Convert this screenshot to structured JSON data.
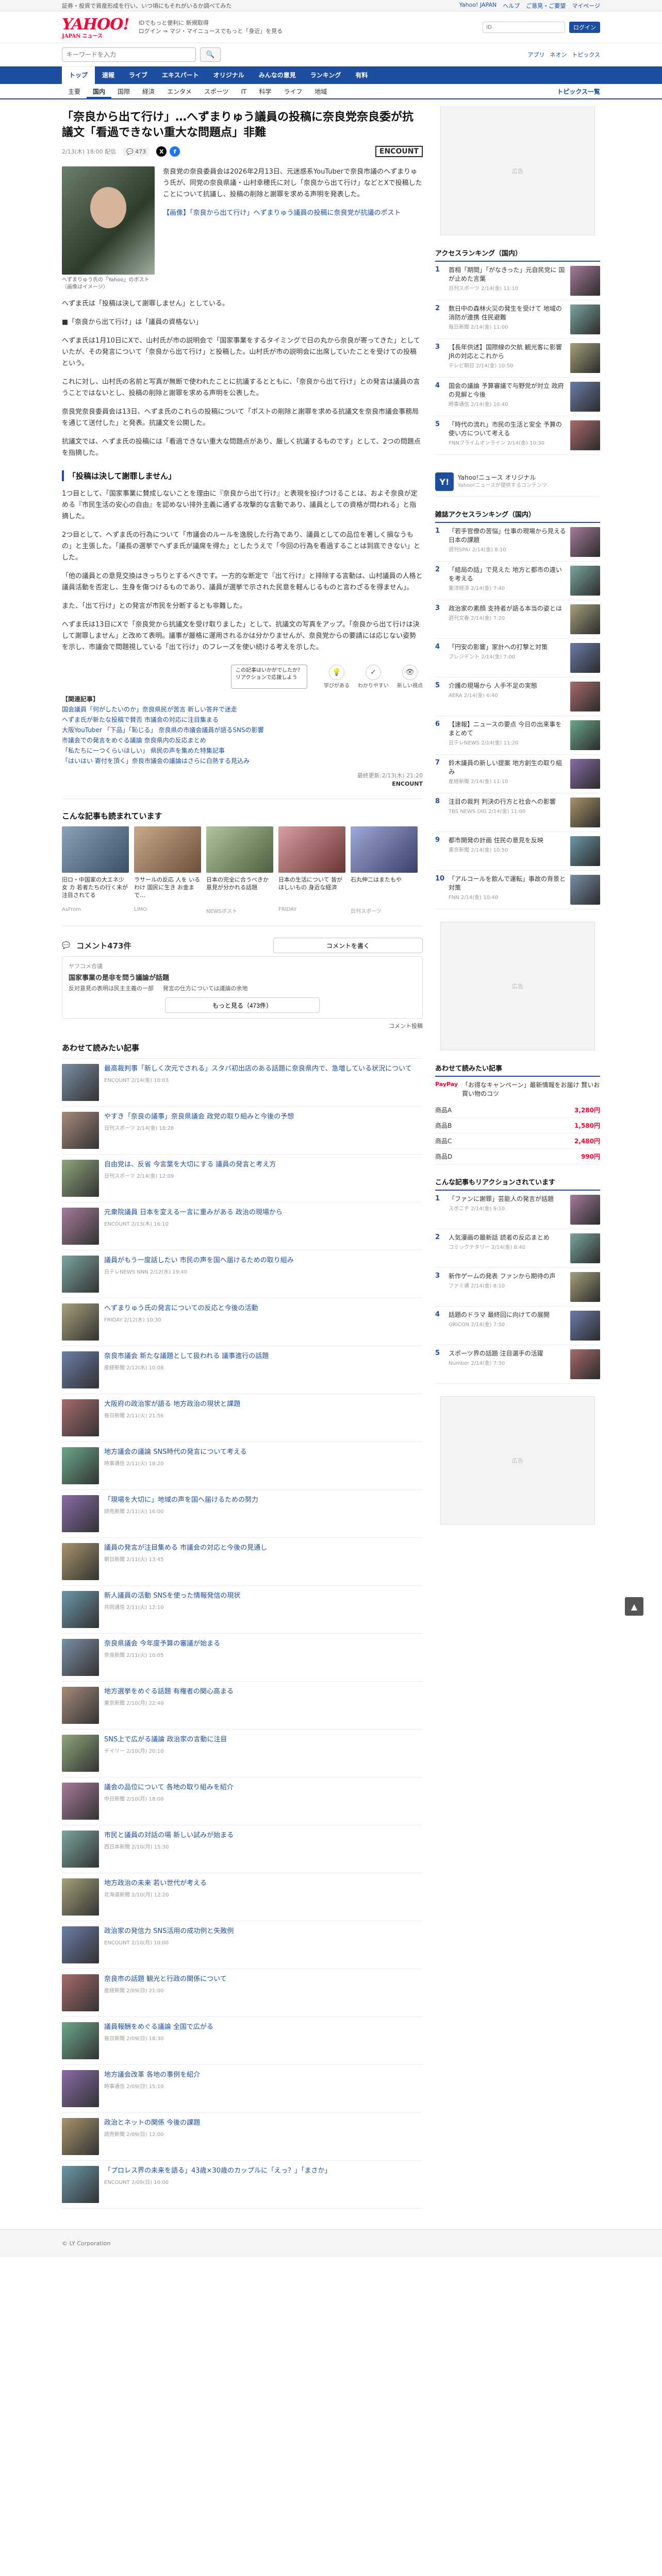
{
  "topstrip": {
    "left": "証券・投資で資産形成を行い、いつ頃にもそれがいるか調べてみた",
    "links": [
      "Yahoo! JAPAN",
      "ヘルプ",
      "ご意見・ご要望",
      "マイページ"
    ]
  },
  "header": {
    "logo": "YAHOO!",
    "logo_sub": "JAPAN ニュース",
    "subnav1": "IDでもっと便利に 新規取得",
    "subnav2": "ログイン ⇒ マジ・マイニュースでもっと「身近」を見る",
    "login_placeholder": "ID",
    "login_btn": "ログイン"
  },
  "search": {
    "placeholder": "キーワードを入力",
    "btn": "検索",
    "right": [
      "アプリ",
      "ネオン",
      "トピックス"
    ]
  },
  "nav": [
    "トップ",
    "速報",
    "ライブ",
    "エキスパート",
    "オリジナル",
    "みんなの意見",
    "ランキング",
    "有料"
  ],
  "subnav": [
    "主要",
    "国内",
    "国際",
    "経済",
    "エンタメ",
    "スポーツ",
    "IT",
    "科学",
    "ライフ",
    "地域"
  ],
  "subnav_right": "トピックス一覧",
  "article": {
    "title": "「奈良から出て行け」…へずまりゅう議員の投稿に奈良党奈良委が抗議文「看過できない重大な問題点」非難",
    "date": "2/13(木) 18:00 配信",
    "comments": "473",
    "provider": "ENCOUNT",
    "photo_caption": "へずまりゅう氏の「Yahoo」のポスト（画像はイメージ）",
    "lead_p1": "奈良党の奈良委員会は2026年2月13日、元迷惑系YouTuberで奈良市議のへずまりゅう氏が、同党の奈良県議・山村幸穂氏に対し「奈良から出て行け」などとXで投稿したことについて抗議し、投稿の削除と謝罪を求める声明を発表した。",
    "lead_link": "【画像】「奈良から出て行け」へずまりゅう議員の投稿に奈良党が抗議のポスト",
    "p1": "へずま氏は「投稿は決して謝罪しません」としている。",
    "p2": "■「奈良から出て行け」は「議員の資格ない」",
    "p3": "へずま氏は1月10日にXで、山村氏が市の説明会で「国家事業をするタイミングで日の丸から奈良が寄ってきた」としていたが、その発言について「奈良から出て行け」と投稿した。山村氏が市の説明会に出席していたことを受けての投稿という。",
    "p4": "これに対し、山村氏の名前と写真が無断で使われたことに抗議するとともに、「奈良から出て行け」との発言は議員の言うことではないとし、投稿の削除と謝罪を求める声明を公表した。",
    "p5": "奈良党奈良委員会は13日、へずま氏のこれらの投稿について「ポストの削除と謝罪を求める抗議文を奈良市議会事務局を通じて送付した」と発表。抗議文を公開した。",
    "p6": "抗議文では、へずま氏の投稿には「看過できない重大な問題点があり、厳しく抗議するものです」として、2つの問題点を指摘した。",
    "h1": "「投稿は決して謝罪しません」",
    "p7": "1つ目として、「国家事業に賛成しないことを理由に『奈良から出て行け』と表現を投げつけることは、およそ奈良が定める『市民生活の安心の自由』を認めない排外主義に通ずる攻撃的な言動であり、議員としての資格が問われる」と指摘した。",
    "p8": "2つ目として、へずま氏の行為について「市議会のルールを逸脱した行為であり、議員としての品位を著しく損なうもの」と主張した。「議長の選挙でへずま氏が議席を得た」としたうえで「今回の行為を看過することは到底できない」とした。",
    "p9": "「他の議員との意見交換はきっちりとするべきです。一方的な断定で『出て行け』と排除する言動は、山村議員の人格と議員活動を否定し、生身を傷つけるものであり、議員が選挙で示された民意を軽んじるものと言わざるを得ません」。",
    "p10": "また、「出て行け」との発言が市民を分断するとも非難した。",
    "p11": "へずま氏は13日にXで「奈良党から抗議文を受け取りました」として、抗議文の写真をアップ。「奈良から出て行けは決して謝罪しません」と改めて表明。議事が厳格に運用されるかは分かりませんが、奈良党からの要請には応じない姿勢を示し、市議会で問題視している「出て行け」のフレーズを使い続ける考えを示した。",
    "tooltip1": "この記事はいかがでしたか？",
    "tooltip2": "リアクションで応援しよう",
    "reactions": [
      "学びがある",
      "わかりやすい",
      "新しい視点"
    ],
    "related_label": "【関連記事】",
    "related": [
      "国会議員「何がしたいのか」奈良県民が苦言 新しい答弁で迷走",
      "ヘずま氏が新たな投稿で賛否 市議会の対応に注目集まる",
      "大阪YouTuber 「下品」「恥じる」 奈良県の市議会議員が語るSNSの影響",
      "市議会での発言をめぐる議論 奈良県内の反応まとめ",
      "「私たちに一つくらいほしい」 県民の声を集めた特集記事",
      "「はいはい 寄付を頂く」奈良市議会の議論はさらに白熱する見込み"
    ],
    "credit_date": "最終更新:2/13(木) 21:20",
    "credit_name": "ENCOUNT"
  },
  "also_read": {
    "title": "こんな記事も読まれています",
    "items": [
      {
        "t": "旧ロ・中国家の大エネ少女 カ 若者たちの行く末が注目されてる",
        "s": "AsFrom"
      },
      {
        "t": "ラサールの反応 人を いるわけ 国民に生き お金まで…",
        "s": "LIMO"
      },
      {
        "t": "日本の完全に合うべきか 意見が分かれる話題",
        "s": "NEWSポスト"
      },
      {
        "t": "日本の生活について 皆がほしいもの 身近な経済",
        "s": "FRIDAY"
      },
      {
        "t": "石丸伸二はまたもや",
        "s": "日刊スポーツ"
      }
    ]
  },
  "comments": {
    "count": "コメント473件",
    "btn": "コメントを書く",
    "box_label": "ヤフコメ合議",
    "box_heading": "国家事業の是非を問う議論が話題",
    "box_items": [
      "反対意見の表明は民主主義の一部",
      "発言の仕方については議論の余地"
    ],
    "more": "もっと見る（473件）",
    "news_check": "コメント投稿"
  },
  "recommend": {
    "title": "あわせて読みたい記事",
    "items": [
      {
        "t": "最高裁判事「新しく次元でされる」スタバ初出店のある話題に奈良県内で、急増している状況について",
        "s": "ENCOUNT 2/14(金) 10:03"
      },
      {
        "t": "やすき「奈良の議事」奈良県議会 政党の取り組みと今後の予想",
        "s": "日刊スポーツ 2/14(金) 18:28"
      },
      {
        "t": "自由党は、反省 今言葉を大切にする 議員の発言と考え方",
        "s": "日刊スポーツ 2/14(金) 12:09"
      },
      {
        "t": "元衆院議員 日本を変える一言に重みがある 政治の現場から",
        "s": "ENCOUNT 2/13(木) 16:10"
      },
      {
        "t": "議員がもう一度話したい 市民の声を国へ届けるための取り組み",
        "s": "日テレNEWS NNN 2/12(水) 19:40"
      },
      {
        "t": "へずまりゅう氏の発言についての反応と今後の活動",
        "s": "FRIDAY 2/12(水) 10:30"
      },
      {
        "t": "奈良市議会 新たな議題として扱われる 議事進行の話題",
        "s": "産経新聞 2/12(水) 10:08"
      },
      {
        "t": "大阪府の政治家が語る 地方政治の現状と課題",
        "s": "毎日新聞 2/11(火) 21:56"
      },
      {
        "t": "地方議会の議論 SNS時代の発言について考える",
        "s": "時事通信 2/11(火) 18:20"
      },
      {
        "t": "「現場を大切に」地域の声を国へ届けるための努力",
        "s": "読売新聞 2/11(火) 16:00"
      },
      {
        "t": "議員の発言が注目集める 市議会の対応と今後の見通し",
        "s": "朝日新聞 2/11(火) 13:45"
      },
      {
        "t": "新人議員の活動 SNSを使った情報発信の現状",
        "s": "共同通信 2/11(火) 12:10"
      },
      {
        "t": "奈良県議会 今年度予算の審議が始まる",
        "s": "奈良新聞 2/11(火) 10:05"
      },
      {
        "t": "地方選挙をめぐる話題 有権者の関心高まる",
        "s": "東京新聞 2/10(月) 22:40"
      },
      {
        "t": "SNS上で広がる議論 政治家の言動に注目",
        "s": "デイリー 2/10(月) 20:10"
      },
      {
        "t": "議会の品位について 各地の取り組みを紹介",
        "s": "中日新聞 2/10(月) 18:00"
      },
      {
        "t": "市民と議員の対話の場 新しい試みが始まる",
        "s": "西日本新聞 2/10(月) 15:30"
      },
      {
        "t": "地方政治の未来 若い世代が考える",
        "s": "北海道新聞 2/10(月) 12:20"
      },
      {
        "t": "政治家の発信力 SNS活用の成功例と失敗例",
        "s": "ENCOUNT 2/10(月) 10:00"
      },
      {
        "t": "奈良市の話題 観光と行政の関係について",
        "s": "産経新聞 2/09(日) 21:00"
      },
      {
        "t": "議員報酬をめぐる議論 全国で広がる",
        "s": "毎日新聞 2/09(日) 18:30"
      },
      {
        "t": "地方議会改革 各地の事例を紹介",
        "s": "時事通信 2/09(日) 15:10"
      },
      {
        "t": "政治とネットの関係 今後の課題",
        "s": "読売新聞 2/09(日) 12:00"
      },
      {
        "t": "「プロレス界の未来を語る」43歳×30歳のカップルに「えっ？」「まさか」",
        "s": "ENCOUNT 2/09(日) 10:00"
      }
    ]
  },
  "sidebar": {
    "ad_label": "広告",
    "access_title": "アクセスランキング（国内）",
    "access": [
      {
        "t": "首相「期間」「がなきった」元自民党に 国が止めた言葉",
        "s": "日刊スポーツ 2/14(金) 11:10"
      },
      {
        "t": "数日中の森林火災の発生を受けて 地域の消防が連携 住民避難",
        "s": "毎日新聞 2/14(金) 11:00"
      },
      {
        "t": "【長年供述】国際線の欠航 観光客に影響 JRの対応とこれから",
        "s": "テレビ朝日 2/14(金) 10:50"
      },
      {
        "t": "国会の議論 予算審議で与野党が対立 政府の見解と今後",
        "s": "時事通信 2/14(金) 10:40"
      },
      {
        "t": "「時代の流れ」市民の生活と安全 予算の使い方について考える",
        "s": "FNNプライムオンライン 2/14(金) 10:30"
      }
    ],
    "orig_title": "Yahoo!ニュース オリジナル",
    "orig_sub": "Yahoo!ニュースが提供するコンテンツ",
    "domestic_title": "雑誌アクセスランキング（国内）",
    "domestic": [
      {
        "t": "「若手官僚の苦悩」仕事の現場から見える日本の課題",
        "s": "週刊SPA! 2/14(金) 8:10"
      },
      {
        "t": "「結局の話」で見えた 地方と都市の違いを考える",
        "s": "東洋経済 2/14(金) 7:40"
      },
      {
        "t": "政治家の素顔 支持者が語る本当の姿とは",
        "s": "週刊文春 2/14(金) 7:20"
      },
      {
        "t": "「円安の影響」家計への打撃と対策",
        "s": "プレジデント 2/14(金) 7:00"
      },
      {
        "t": "介護の現場から 人手不足の実態",
        "s": "AERA 2/14(金) 6:40"
      }
    ],
    "domestic_ranks": [
      {
        "t": "【速報】ニュースの要点 今日の出来事をまとめて",
        "s": "日テレNEWS 2/14(金) 11:20"
      },
      {
        "t": "鈴木議員の新しい提案 地方創生の取り組み",
        "s": "産経新聞 2/14(金) 11:10"
      },
      {
        "t": "注目の裁判 判決の行方と社会への影響",
        "s": "TBS NEWS DIG 2/14(金) 11:00"
      },
      {
        "t": "都市開発の計画 住民の意見を反映",
        "s": "東京新聞 2/14(金) 10:50"
      },
      {
        "t": "「アルコールを飲んで運転」事故の背景と対策",
        "s": "FNN 2/14(金) 10:40"
      }
    ],
    "paypay_title": "あわせて読みたい記事",
    "paypay": [
      {
        "tag": "PayPay",
        "t": "「お得なキャンペーン」最新情報をお届け 賢いお買い物のコツ"
      }
    ],
    "prices": [
      {
        "k": "商品A",
        "v": "3,280円"
      },
      {
        "k": "商品B",
        "v": "1,580円"
      },
      {
        "k": "商品C",
        "v": "2,480円"
      },
      {
        "k": "商品D",
        "v": "990円"
      }
    ],
    "reco_title": "こんな記事もリアクションされています",
    "reco": [
      {
        "t": "「ファンに謝罪」芸能人の発言が話題",
        "s": "スポニチ 2/14(金) 9:10"
      },
      {
        "t": "人気漫画の最新話 読者の反応まとめ",
        "s": "コミックナタリー 2/14(金) 8:40"
      },
      {
        "t": "新作ゲームの発表 ファンから期待の声",
        "s": "ファミ通 2/14(金) 8:10"
      },
      {
        "t": "話題のドラマ 最終回に向けての展開",
        "s": "ORICON 2/14(金) 7:50"
      },
      {
        "t": "スポーツ界の話題 注目選手の活躍",
        "s": "Number 2/14(金) 7:30"
      }
    ]
  },
  "backtop": "▲",
  "footer": "© LY Corporation"
}
